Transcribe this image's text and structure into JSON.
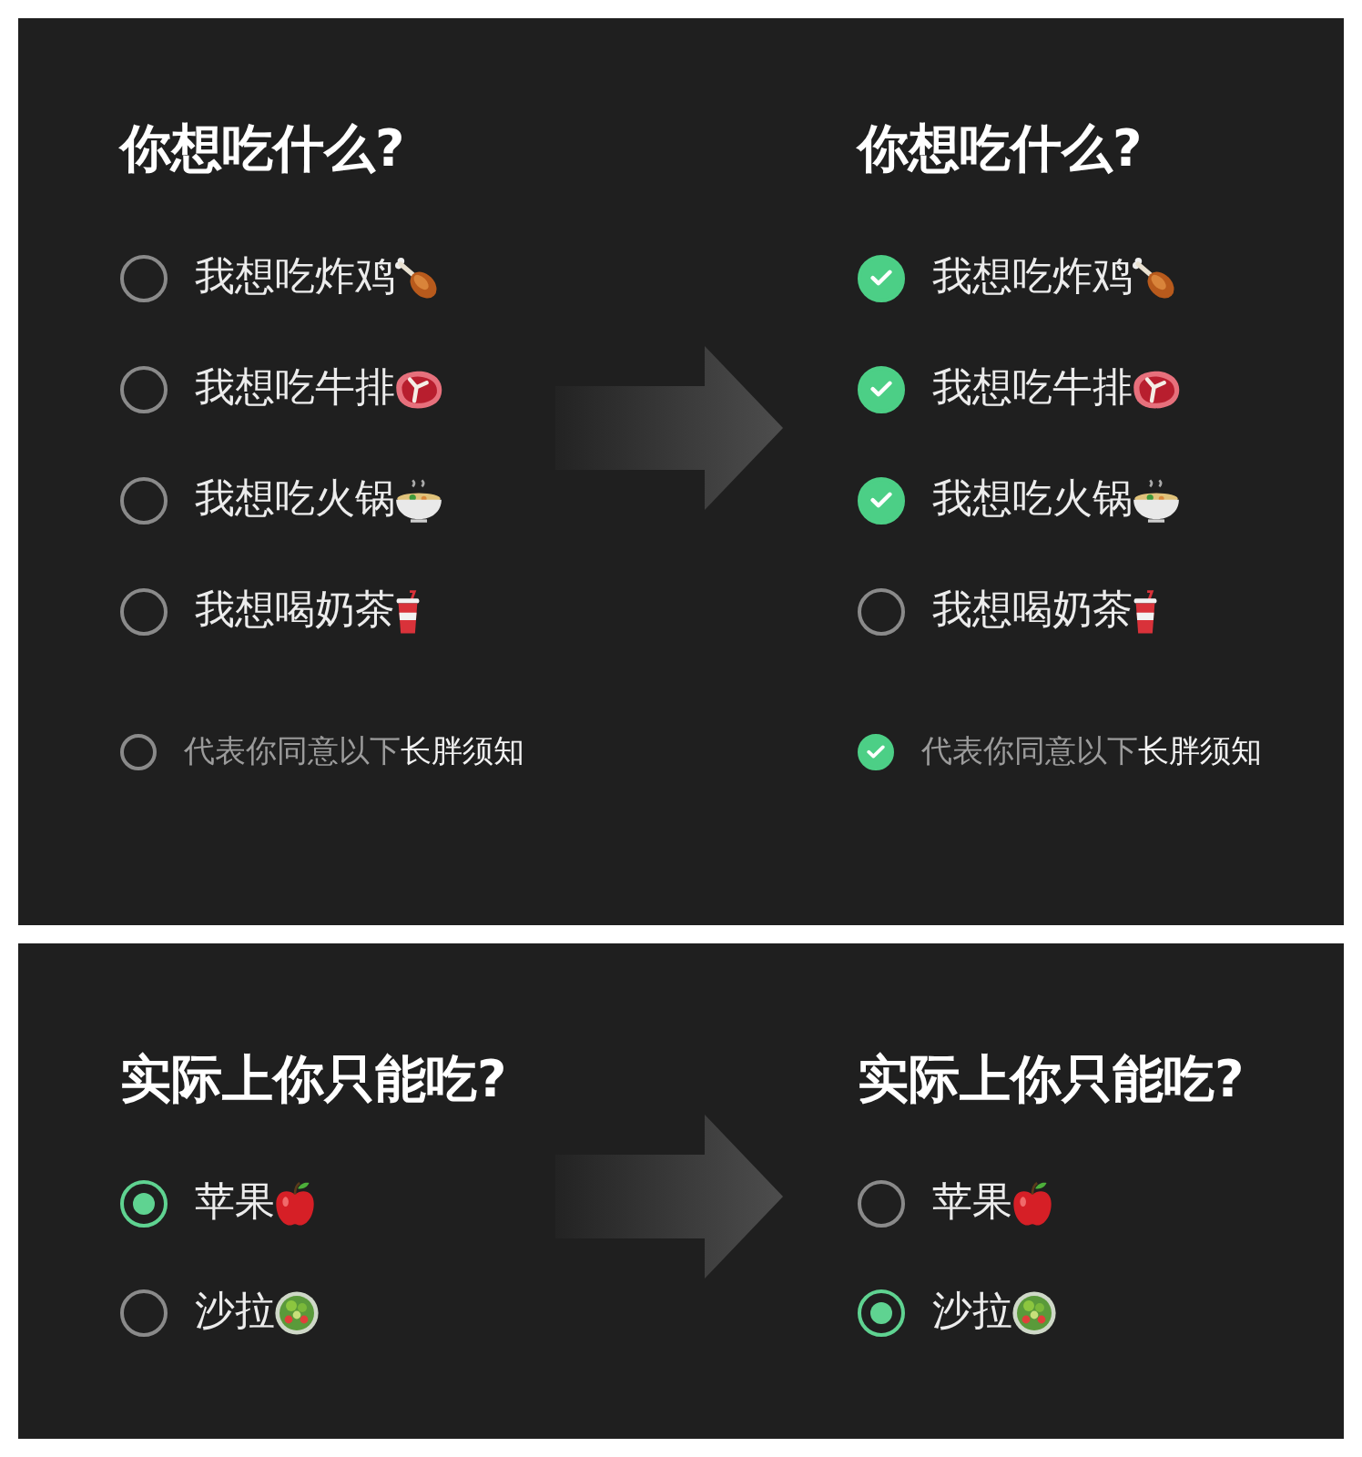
{
  "panels": [
    {
      "kind": "checklist",
      "columns": [
        {
          "title": "你想吃什么?",
          "options": [
            {
              "label": "我想吃炸鸡",
              "checked": false
            },
            {
              "label": "我想吃牛排",
              "checked": false
            },
            {
              "label": "我想吃火锅",
              "checked": false
            },
            {
              "label": "我想喝奶茶",
              "checked": false
            }
          ],
          "agreement": {
            "text": "代表你同意以下",
            "link": "长胖须知",
            "checked": false
          }
        },
        {
          "title": "你想吃什么?",
          "options": [
            {
              "label": "我想吃炸鸡",
              "checked": true
            },
            {
              "label": "我想吃牛排",
              "checked": true
            },
            {
              "label": "我想吃火锅",
              "checked": true
            },
            {
              "label": "我想喝奶茶",
              "checked": false
            }
          ],
          "agreement": {
            "text": "代表你同意以下",
            "link": "长胖须知",
            "checked": true
          }
        }
      ]
    },
    {
      "kind": "radio",
      "columns": [
        {
          "title": "实际上你只能吃?",
          "options": [
            {
              "label": "苹果",
              "selected": true
            },
            {
              "label": "沙拉",
              "selected": false
            }
          ]
        },
        {
          "title": "实际上你只能吃?",
          "options": [
            {
              "label": "苹果",
              "selected": false
            },
            {
              "label": "沙拉",
              "selected": true
            }
          ]
        }
      ]
    }
  ]
}
